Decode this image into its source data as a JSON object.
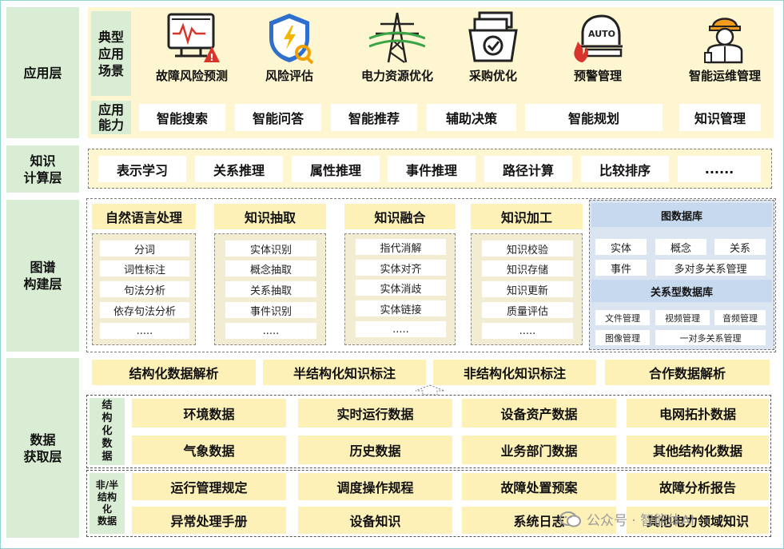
{
  "layers": {
    "application": "应用层",
    "knowledge_compute": "知识\n计算层",
    "graph_build": "图谱\n构建层",
    "data_acquire": "数据\n获取层"
  },
  "application": {
    "scene_label": "典型\n应用\n场景",
    "scenes": [
      {
        "label": "故障风险预测",
        "icon": "fault-monitor-icon"
      },
      {
        "label": "风险评估",
        "icon": "shield-search-icon"
      },
      {
        "label": "电力资源优化",
        "icon": "power-tower-icon"
      },
      {
        "label": "采购优化",
        "icon": "purchase-check-icon"
      },
      {
        "label": "预警管理",
        "icon": "auto-alert-icon"
      },
      {
        "label": "智能运维管理",
        "icon": "worker-icon"
      }
    ],
    "capability_label": "应用\n能力",
    "capabilities": [
      "智能搜索",
      "智能问答",
      "智能推荐",
      "辅助决策",
      "智能规划",
      "知识管理"
    ],
    "auto_badge": "AUTO"
  },
  "knowledge_compute": {
    "items": [
      "表示学习",
      "关系推理",
      "属性推理",
      "事件推理",
      "路径计算",
      "比较排序",
      "......"
    ]
  },
  "graph_build": {
    "columns": [
      {
        "title": "自然语言处理",
        "items": [
          "分词",
          "词性标注",
          "句法分析",
          "依存句法分析",
          "....."
        ]
      },
      {
        "title": "知识抽取",
        "items": [
          "实体识别",
          "概念抽取",
          "关系抽取",
          "事件识别",
          "....."
        ]
      },
      {
        "title": "知识融合",
        "items": [
          "指代消解",
          "实体对齐",
          "实体消歧",
          "实体链接",
          "....."
        ]
      },
      {
        "title": "知识加工",
        "items": [
          "知识校验",
          "知识存储",
          "知识更新",
          "质量评估",
          "....."
        ]
      }
    ],
    "graph_db": {
      "title": "图数据库",
      "row1": [
        "实体",
        "概念",
        "关系"
      ],
      "row2": [
        "事件",
        "多对多关系管理"
      ]
    },
    "relational_db": {
      "title": "关系型数据库",
      "row1": [
        "文件管理",
        "视频管理",
        "音频管理"
      ],
      "row2": [
        "图像管理",
        "一对多关系管理"
      ]
    }
  },
  "data_acquire": {
    "parse_items": [
      "结构化数据解析",
      "半结构化知识标注",
      "非结构化知识标注",
      "合作数据解析"
    ],
    "structured_label": "结\n构\n化\n数\n据",
    "structured_rows": [
      [
        "环境数据",
        "实时运行数据",
        "设备资产数据",
        "电网拓扑数据"
      ],
      [
        "气象数据",
        "历史数据",
        "业务部门数据",
        "其他结构化数据"
      ]
    ],
    "unstructured_label": "非/半\n结构\n化\n数据",
    "unstructured_rows": [
      [
        "运行管理规定",
        "调度操作规程",
        "故障处置预案",
        "故障分析报告"
      ],
      [
        "异常处理手册",
        "设备知识",
        "系统日志",
        "其他电力领域知识"
      ]
    ]
  },
  "watermark": "公众号 · 智能体AI",
  "colors": {
    "layer_green": "#d8edd3",
    "panel_yellow": "#fdf6d0",
    "card_yellow": "#fdf1b8",
    "db_blue": "#dbe5f1",
    "shield_blue": "#2f6fce",
    "alert_red": "#d9342b",
    "tower_green": "#3aa545"
  }
}
